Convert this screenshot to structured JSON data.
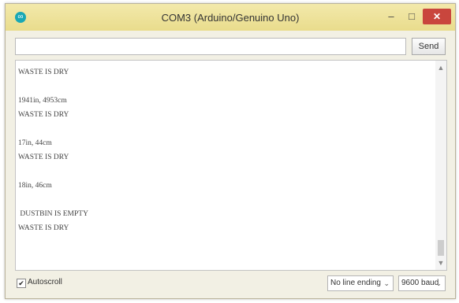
{
  "window": {
    "title": "COM3 (Arduino/Genuino Uno)"
  },
  "controls": {
    "minimize": "–",
    "maximize": "□",
    "close": "✕"
  },
  "input": {
    "value": "",
    "send_label": "Send"
  },
  "output_lines": [
    "WASTE IS DRY",
    "",
    "1941in, 4953cm",
    "WASTE IS DRY",
    "",
    "17in, 44cm",
    "WASTE IS DRY",
    "",
    "18in, 46cm",
    "",
    " DUSTBIN IS EMPTY",
    "WASTE IS DRY"
  ],
  "footer": {
    "autoscroll_label": "Autoscroll",
    "autoscroll_checked": true,
    "line_ending": "No line ending",
    "baud": "9600 baud"
  }
}
